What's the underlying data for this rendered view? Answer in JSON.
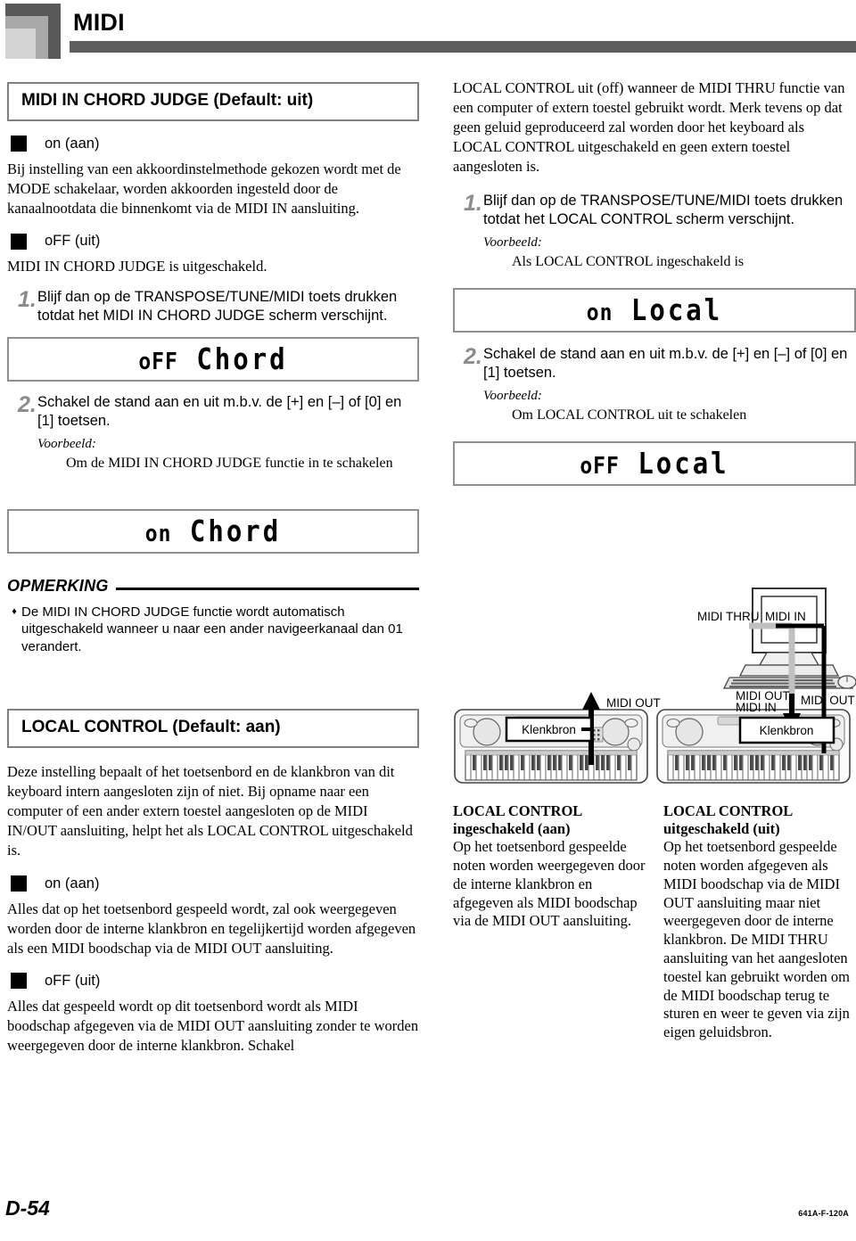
{
  "header": {
    "title": "MIDI",
    "logo_icon": "nested-squares-logo"
  },
  "left_column": {
    "section_title": "MIDI IN CHORD JUDGE (Default: uit)",
    "option_on": {
      "label": "on (aan)",
      "body": "Bij instelling van een akkoordinstelmethode gekozen wordt met de MODE schakelaar, worden akkoorden ingesteld door de kanaalnootdata die binnenkomt via de MIDI IN aansluiting."
    },
    "option_off": {
      "label": "oFF (uit)",
      "body": "MIDI IN CHORD JUDGE is uitgeschakeld."
    },
    "step1": {
      "number": "1.",
      "text": "Blijf dan op de TRANSPOSE/TUNE/MIDI toets drukken totdat het MIDI IN CHORD JUDGE scherm verschijnt."
    },
    "lcd1": {
      "state": "oFF",
      "label": "Chord"
    },
    "step2": {
      "number": "2.",
      "text": "Schakel de stand aan en uit m.b.v. de [+] en [–] of [0] en [1] toetsen.",
      "example_label": "Voorbeeld:",
      "example_body": "Om de MIDI IN CHORD JUDGE functie in te schakelen"
    },
    "lcd2": {
      "state": "on",
      "label": "Chord"
    },
    "note": {
      "title": "OPMERKING",
      "bullet": "♦",
      "text": "De MIDI IN CHORD JUDGE functie wordt automatisch uitgeschakeld wanneer u naar een ander navigeerkanaal dan 01 verandert."
    },
    "local_control": {
      "section_title": "LOCAL CONTROL (Default: aan)",
      "intro": "Deze instelling bepaalt of het toetsenbord en de klankbron van dit keyboard intern aangesloten zijn of niet. Bij opname naar een computer of een ander extern toestel aangesloten op de MIDI IN/OUT aansluiting, helpt het als LOCAL CONTROL uitgeschakeld is.",
      "option_on": {
        "label": "on (aan)",
        "body": "Alles dat op het toetsenbord gespeeld wordt, zal ook weergegeven worden door de interne klankbron en tegelijkertijd worden afgegeven als een MIDI boodschap via de MIDI OUT aansluiting."
      },
      "option_off": {
        "label": "oFF (uit)",
        "body": "Alles dat gespeeld wordt op dit toetsenbord wordt als MIDI boodschap afgegeven via de MIDI OUT aansluiting zonder te worden weergegeven door de interne klankbron. Schakel"
      }
    }
  },
  "right_column": {
    "intro": "LOCAL CONTROL uit (off) wanneer de MIDI THRU functie van een computer of extern toestel gebruikt wordt. Merk tevens op dat geen geluid geproduceerd zal worden door het keyboard als LOCAL CONTROL uitgeschakeld en geen extern toestel aangesloten is.",
    "step1": {
      "number": "1.",
      "text": "Blijf dan op de TRANSPOSE/TUNE/MIDI toets drukken totdat het LOCAL CONTROL scherm verschijnt.",
      "example_label": "Voorbeeld:",
      "example_body": "Als LOCAL CONTROL ingeschakeld is"
    },
    "lcd1": {
      "state": "on",
      "label": "Local"
    },
    "step2": {
      "number": "2.",
      "text": "Schakel de stand aan en uit m.b.v. de [+] en [–] of [0] en [1] toetsen.",
      "example_label": "Voorbeeld:",
      "example_body": "Om LOCAL CONTROL uit te schakelen"
    },
    "lcd2": {
      "state": "oFF",
      "label": "Local"
    }
  },
  "diagram": {
    "left_keyboard": {
      "sound_source_label": "Klenkbron",
      "midi_out_label": "MIDI OUT"
    },
    "right_setup": {
      "midi_thru_label": "MIDI THRU",
      "midi_in_label": "MIDI IN",
      "midi_out_in_label_1": "MIDI OUT",
      "midi_out_in_label_2": "MIDI IN",
      "midi_out_label": "MIDI OUT",
      "sound_source_label": "Klenkbron"
    }
  },
  "lower_right": {
    "col1": {
      "heading_line1": "LOCAL CONTROL",
      "heading_line2": "ingeschakeld (aan)",
      "body": "Op het toetsenbord gespeelde noten worden weergegeven door de interne klankbron en afgegeven als MIDI boodschap via de MIDI OUT aansluiting."
    },
    "col2": {
      "heading_line1": "LOCAL CONTROL",
      "heading_line2": "uitgeschakeld (uit)",
      "body": "Op het toetsenbord gespeelde noten worden afgegeven als MIDI boodschap via de MIDI OUT aansluiting maar niet weergegeven door de interne klankbron. De MIDI THRU aansluiting van het aangesloten toestel kan gebruikt worden om de MIDI boodschap terug te sturen en weer te geven via zijn eigen geluidsbron."
    }
  },
  "footer": {
    "page_number": "D-54",
    "doc_code": "641A-F-120A"
  }
}
